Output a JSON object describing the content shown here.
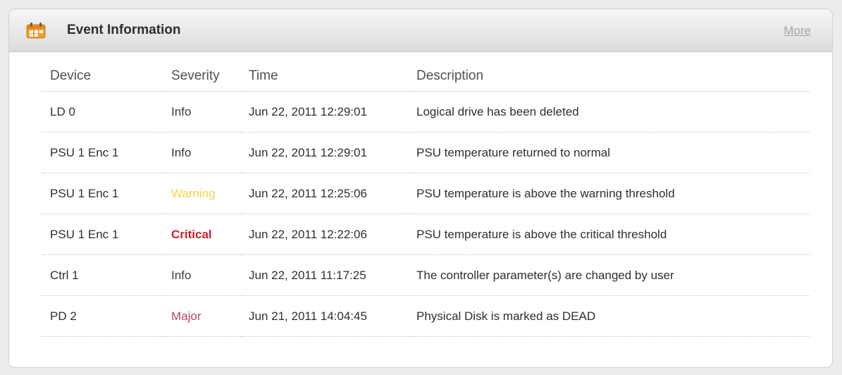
{
  "panel": {
    "title": "Event Information",
    "more_label": "More",
    "icon": "calendar-icon"
  },
  "table": {
    "columns": [
      "Device",
      "Severity",
      "Time",
      "Description"
    ],
    "rows": [
      {
        "device": "LD 0",
        "severity": "Info",
        "severity_level": "info",
        "time": "Jun 22, 2011 12:29:01",
        "description": "Logical drive has been deleted"
      },
      {
        "device": "PSU 1 Enc 1",
        "severity": "Info",
        "severity_level": "info",
        "time": "Jun 22, 2011 12:29:01",
        "description": "PSU temperature returned to normal"
      },
      {
        "device": "PSU 1 Enc 1",
        "severity": "Warning",
        "severity_level": "warning",
        "time": "Jun 22, 2011 12:25:06",
        "description": "PSU temperature is above the warning threshold"
      },
      {
        "device": "PSU 1 Enc 1",
        "severity": "Critical",
        "severity_level": "critical",
        "time": "Jun 22, 2011 12:22:06",
        "description": "PSU temperature is above the critical threshold"
      },
      {
        "device": "Ctrl 1",
        "severity": "Info",
        "severity_level": "info",
        "time": "Jun 22, 2011 11:17:25",
        "description": "The controller parameter(s) are changed by user"
      },
      {
        "device": "PD 2",
        "severity": "Major",
        "severity_level": "major",
        "time": "Jun 21, 2011 14:04:45",
        "description": "Physical Disk is marked as DEAD"
      }
    ]
  },
  "colors": {
    "warning": "#f2d64b",
    "critical": "#cc1f2a",
    "major": "#b34a5e",
    "icon": "#f0a030"
  }
}
